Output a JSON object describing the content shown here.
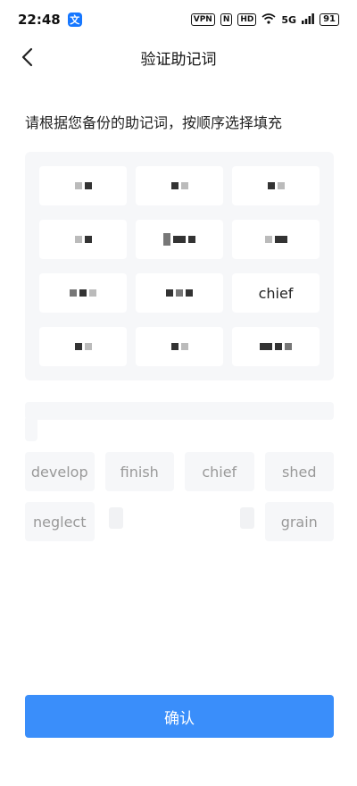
{
  "status": {
    "time": "22:48",
    "app_icon": "文",
    "vpn": "VPN",
    "nfc": "N",
    "hd": "HD",
    "net": "5G",
    "battery": "91"
  },
  "nav": {
    "title": "验证助记词"
  },
  "instruction": "请根据您备份的助记词，按顺序选择填充",
  "grid": {
    "slot_9": "chief"
  },
  "choices": [
    "develop",
    "finish",
    "chief",
    "shed",
    "neglect",
    "grain"
  ],
  "confirm_label": "确认",
  "colors": {
    "primary": "#3a8efa",
    "panel": "#f6f7f9",
    "muted_text": "#999999"
  }
}
